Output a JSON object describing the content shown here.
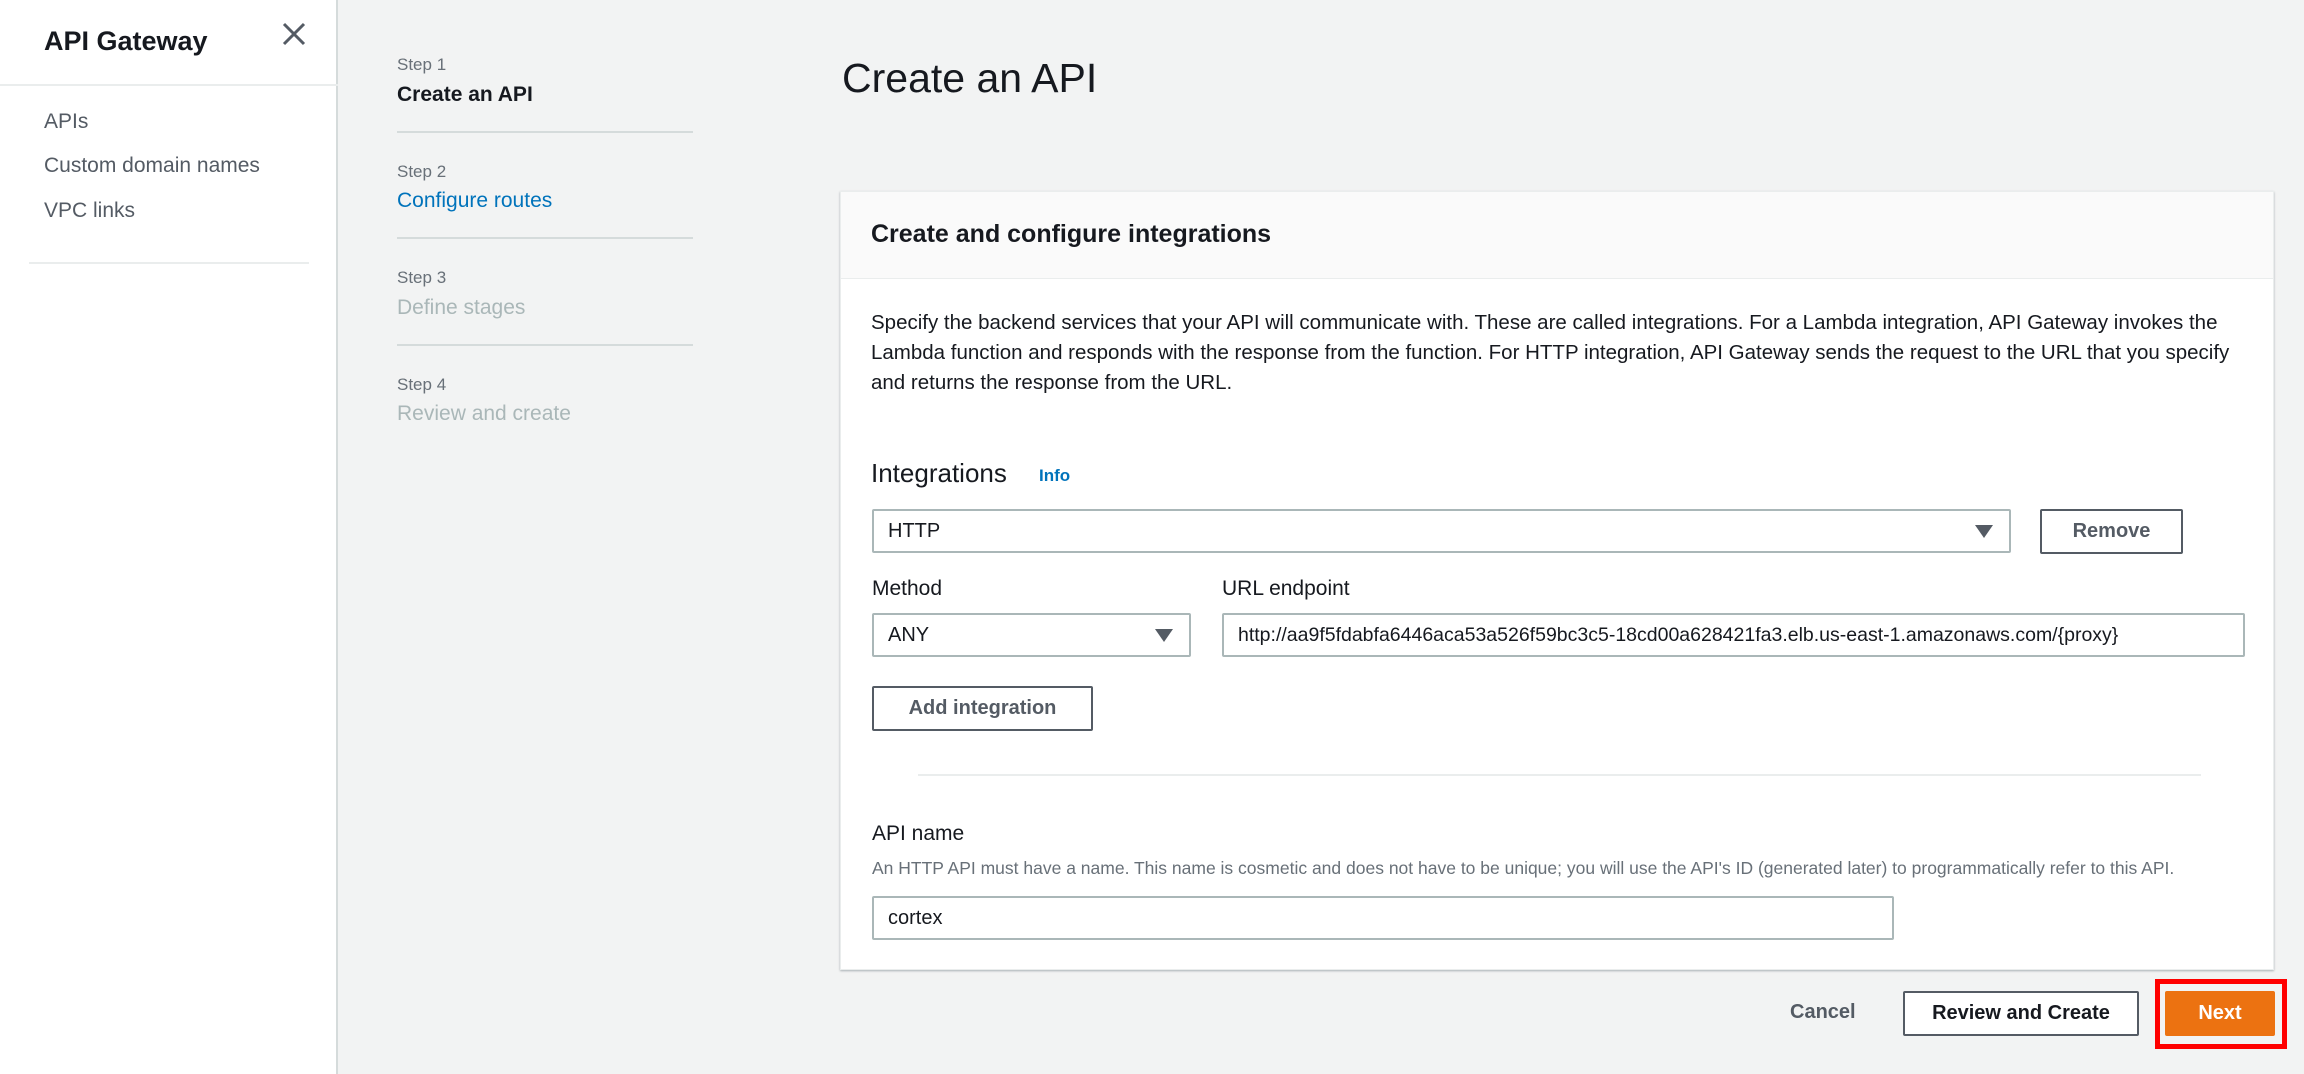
{
  "sidebar": {
    "title": "API Gateway",
    "items": [
      {
        "label": "APIs"
      },
      {
        "label": "Custom domain names"
      },
      {
        "label": "VPC links"
      }
    ]
  },
  "steps": [
    {
      "step": "Step 1",
      "title": "Create an API",
      "state": "current"
    },
    {
      "step": "Step 2",
      "title": "Configure routes",
      "state": "link"
    },
    {
      "step": "Step 3",
      "title": "Define stages",
      "state": "disabled"
    },
    {
      "step": "Step 4",
      "title": "Review and create",
      "state": "disabled"
    }
  ],
  "page": {
    "title": "Create an API"
  },
  "panel": {
    "title": "Create and configure integrations",
    "description": "Specify the backend services that your API will communicate with. These are called integrations. For a Lambda integration, API Gateway invokes the Lambda function and responds with the response from the function. For HTTP integration, API Gateway sends the request to the URL that you specify and returns the response from the URL.",
    "integrations_label": "Integrations",
    "info": "Info",
    "integration_type": "HTTP",
    "remove": "Remove",
    "method_label": "Method",
    "method": "ANY",
    "url_label": "URL endpoint",
    "url": "http://aa9f5fdabfa6446aca53a526f59bc3c5-18cd00a628421fa3.elb.us-east-1.amazonaws.com/{proxy}",
    "add_integration": "Add integration",
    "api_name_label": "API name",
    "api_name_help": "An HTTP API must have a name. This name is cosmetic and does not have to be unique; you will use the API's ID (generated later) to programmatically refer to this API.",
    "api_name": "cortex"
  },
  "footer": {
    "cancel": "Cancel",
    "review": "Review and Create",
    "next": "Next"
  },
  "colors": {
    "accent": "#ec7211",
    "link": "#0073bb",
    "highlight": "#ff0000"
  }
}
